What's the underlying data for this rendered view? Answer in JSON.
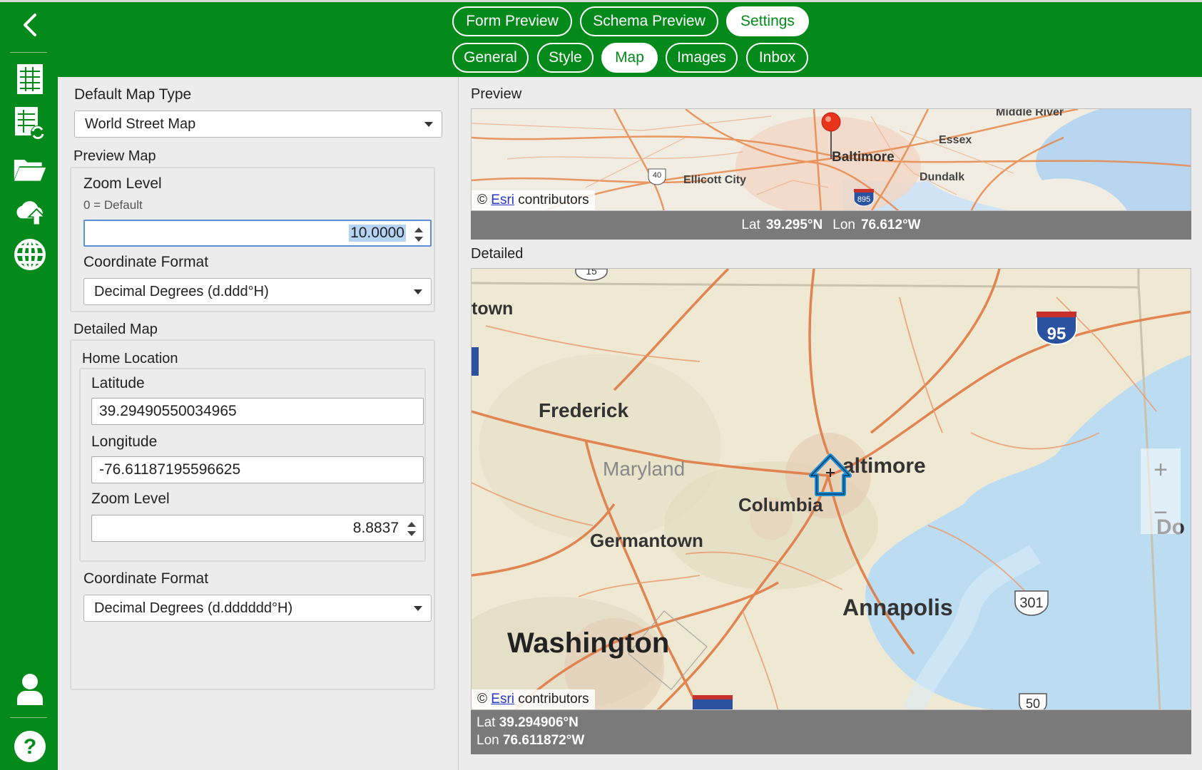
{
  "top_tabs": [
    {
      "label": "Form Preview",
      "active": false
    },
    {
      "label": "Schema Preview",
      "active": false
    },
    {
      "label": "Settings",
      "active": true
    }
  ],
  "sub_tabs": [
    {
      "label": "General",
      "active": false
    },
    {
      "label": "Style",
      "active": false
    },
    {
      "label": "Map",
      "active": true
    },
    {
      "label": "Images",
      "active": false
    },
    {
      "label": "Inbox",
      "active": false
    }
  ],
  "sidebar": {
    "icons": [
      "back-chevron-icon",
      "spreadsheet-icon",
      "spreadsheet-sync-icon",
      "folder-icon",
      "cloud-upload-icon",
      "globe-icon",
      "user-icon",
      "help-icon"
    ]
  },
  "colors": {
    "brand": "#038a1b",
    "selection": "#b4d3f5",
    "link": "#2a36c8",
    "coord_bar": "#7a7a7a"
  },
  "left": {
    "default_map_type_label": "Default Map Type",
    "default_map_type_value": "World Street Map",
    "preview_map_label": "Preview Map",
    "preview_zoom_label": "Zoom Level",
    "preview_zoom_hint": "0 = Default",
    "preview_zoom_value": "10.0000",
    "preview_coord_label": "Coordinate Format",
    "preview_coord_value": "Decimal Degrees (d.ddd°H)",
    "detailed_map_label": "Detailed Map",
    "home_location_label": "Home Location",
    "latitude_label": "Latitude",
    "latitude_value": "39.29490550034965",
    "longitude_label": "Longitude",
    "longitude_value": "-76.61187195596625",
    "detailed_zoom_label": "Zoom Level",
    "detailed_zoom_value": "8.8837",
    "detailed_coord_label": "Coordinate Format",
    "detailed_coord_value": "Decimal Degrees (d.dddddd°H)"
  },
  "preview": {
    "title": "Preview",
    "attribution_prefix": "©",
    "attribution_link": "Esri",
    "attribution_suffix": "contributors",
    "lat_label": "Lat",
    "lat_value": "39.295°N",
    "lon_label": "Lon",
    "lon_value": "76.612°W",
    "place_labels": [
      "Middle River",
      "Essex",
      "Baltimore",
      "Ellicott City",
      "Dundalk"
    ],
    "road_shields": [
      "40",
      "895"
    ]
  },
  "detailed": {
    "title": "Detailed",
    "attribution_prefix": "©",
    "attribution_link": "Esri",
    "attribution_suffix": "contributors",
    "lat_label": "Lat",
    "lat_value": "39.294906°N",
    "lon_label": "Lon",
    "lon_value": "76.611872°W",
    "zoom_in": "+",
    "zoom_out": "−",
    "place_labels": {
      "town": "town",
      "frederick": "Frederick",
      "maryland": "Maryland",
      "baltimore": "altimore",
      "columbia": "Columbia",
      "germantown": "Germantown",
      "annapolis": "Annapolis",
      "washington": "Washington",
      "do": "Do"
    },
    "road_shields": [
      "95",
      "301",
      "50",
      "15"
    ]
  }
}
